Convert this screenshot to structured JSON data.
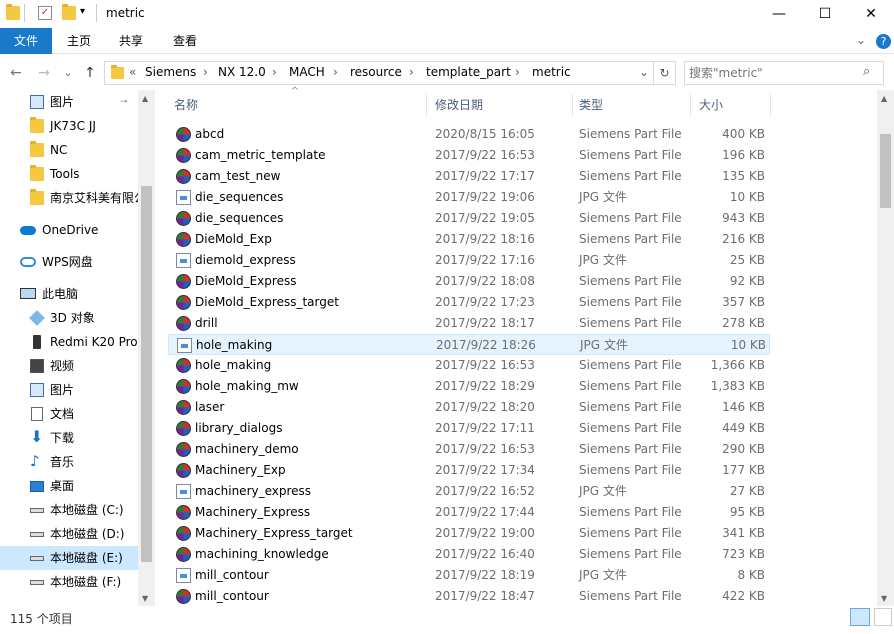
{
  "window": {
    "title": "metric",
    "minimize": "—",
    "maximize": "☐",
    "close": "✕"
  },
  "ribbon": {
    "tabs": [
      "文件",
      "主页",
      "共享",
      "查看"
    ],
    "expand": "⌄",
    "help": "?"
  },
  "nav": {
    "back": "←",
    "forward": "→",
    "recent": "⌄",
    "up": "↑"
  },
  "address": {
    "overflow": "«",
    "crumbs": [
      "Siemens",
      "NX 12.0",
      "MACH",
      "resource",
      "template_part",
      "metric"
    ],
    "separator": "›",
    "dropdown": "⌄",
    "refresh": "↻"
  },
  "search": {
    "placeholder": "搜索\"metric\"",
    "icon": "⌕"
  },
  "sidebar": {
    "items": [
      {
        "label": "图片",
        "icon": "pictures-icon",
        "pin": "📌"
      },
      {
        "label": "JK73C  JJ",
        "icon": "folder-icon"
      },
      {
        "label": "NC",
        "icon": "folder-icon"
      },
      {
        "label": "Tools",
        "icon": "folder-icon"
      },
      {
        "label": "南京艾科美有限公",
        "icon": "folder-shared-icon"
      },
      {
        "label": "OneDrive",
        "icon": "cloud-icon"
      },
      {
        "label": "WPS网盘",
        "icon": "wps-cloud-icon"
      },
      {
        "label": "此电脑",
        "icon": "pc-icon"
      },
      {
        "label": "3D 对象",
        "icon": "3d-objects-icon"
      },
      {
        "label": "Redmi K20 Pro",
        "icon": "phone-icon"
      },
      {
        "label": "视频",
        "icon": "video-icon"
      },
      {
        "label": "图片",
        "icon": "pictures-icon"
      },
      {
        "label": "文档",
        "icon": "documents-icon"
      },
      {
        "label": "下载",
        "icon": "download-icon"
      },
      {
        "label": "音乐",
        "icon": "music-icon"
      },
      {
        "label": "桌面",
        "icon": "desktop-icon"
      },
      {
        "label": "本地磁盘 (C:)",
        "icon": "drive-icon"
      },
      {
        "label": "本地磁盘 (D:)",
        "icon": "drive-icon"
      },
      {
        "label": "本地磁盘 (E:)",
        "icon": "drive-icon",
        "selected": true
      },
      {
        "label": "本地磁盘 (F:)",
        "icon": "drive-icon"
      }
    ]
  },
  "columns": {
    "name": "名称",
    "date": "修改日期",
    "type": "类型",
    "size": "大小",
    "sort": "^"
  },
  "files": [
    {
      "name": "abcd",
      "date": "2020/8/15 16:05",
      "type": "Siemens Part File",
      "size": "400 KB",
      "icon": "prt"
    },
    {
      "name": "cam_metric_template",
      "date": "2017/9/22 16:53",
      "type": "Siemens Part File",
      "size": "196 KB",
      "icon": "prt"
    },
    {
      "name": "cam_test_new",
      "date": "2017/9/22 17:17",
      "type": "Siemens Part File",
      "size": "135 KB",
      "icon": "prt"
    },
    {
      "name": "die_sequences",
      "date": "2017/9/22 19:06",
      "type": "JPG 文件",
      "size": "10 KB",
      "icon": "jpg"
    },
    {
      "name": "die_sequences",
      "date": "2017/9/22 19:05",
      "type": "Siemens Part File",
      "size": "943 KB",
      "icon": "prt"
    },
    {
      "name": "DieMold_Exp",
      "date": "2017/9/22 18:16",
      "type": "Siemens Part File",
      "size": "216 KB",
      "icon": "prt"
    },
    {
      "name": "diemold_express",
      "date": "2017/9/22 17:16",
      "type": "JPG 文件",
      "size": "25 KB",
      "icon": "jpg"
    },
    {
      "name": "DieMold_Express",
      "date": "2017/9/22 18:08",
      "type": "Siemens Part File",
      "size": "92 KB",
      "icon": "prt"
    },
    {
      "name": "DieMold_Express_target",
      "date": "2017/9/22 17:23",
      "type": "Siemens Part File",
      "size": "357 KB",
      "icon": "prt"
    },
    {
      "name": "drill",
      "date": "2017/9/22 18:17",
      "type": "Siemens Part File",
      "size": "278 KB",
      "icon": "prt"
    },
    {
      "name": "hole_making",
      "date": "2017/9/22 18:26",
      "type": "JPG 文件",
      "size": "10 KB",
      "icon": "jpg",
      "hover": true
    },
    {
      "name": "hole_making",
      "date": "2017/9/22 16:53",
      "type": "Siemens Part File",
      "size": "1,366 KB",
      "icon": "prt"
    },
    {
      "name": "hole_making_mw",
      "date": "2017/9/22 18:29",
      "type": "Siemens Part File",
      "size": "1,383 KB",
      "icon": "prt"
    },
    {
      "name": "laser",
      "date": "2017/9/22 18:20",
      "type": "Siemens Part File",
      "size": "146 KB",
      "icon": "prt"
    },
    {
      "name": "library_dialogs",
      "date": "2017/9/22 17:11",
      "type": "Siemens Part File",
      "size": "449 KB",
      "icon": "prt"
    },
    {
      "name": "machinery_demo",
      "date": "2017/9/22 16:53",
      "type": "Siemens Part File",
      "size": "290 KB",
      "icon": "prt"
    },
    {
      "name": "Machinery_Exp",
      "date": "2017/9/22 17:34",
      "type": "Siemens Part File",
      "size": "177 KB",
      "icon": "prt"
    },
    {
      "name": "machinery_express",
      "date": "2017/9/22 16:52",
      "type": "JPG 文件",
      "size": "27 KB",
      "icon": "jpg"
    },
    {
      "name": "Machinery_Express",
      "date": "2017/9/22 17:44",
      "type": "Siemens Part File",
      "size": "95 KB",
      "icon": "prt"
    },
    {
      "name": "Machinery_Express_target",
      "date": "2017/9/22 19:00",
      "type": "Siemens Part File",
      "size": "341 KB",
      "icon": "prt"
    },
    {
      "name": "machining_knowledge",
      "date": "2017/9/22 16:40",
      "type": "Siemens Part File",
      "size": "723 KB",
      "icon": "prt"
    },
    {
      "name": "mill_contour",
      "date": "2017/9/22 18:19",
      "type": "JPG 文件",
      "size": "8 KB",
      "icon": "jpg"
    },
    {
      "name": "mill_contour",
      "date": "2017/9/22 18:47",
      "type": "Siemens Part File",
      "size": "422 KB",
      "icon": "prt"
    }
  ],
  "status": {
    "count": "115 个项目"
  },
  "colors": {
    "accent": "#1979ca",
    "selection": "#cce8ff",
    "hover": "#e5f3ff",
    "header_text": "#4c607a",
    "secondary_text": "#6d6d6d"
  }
}
